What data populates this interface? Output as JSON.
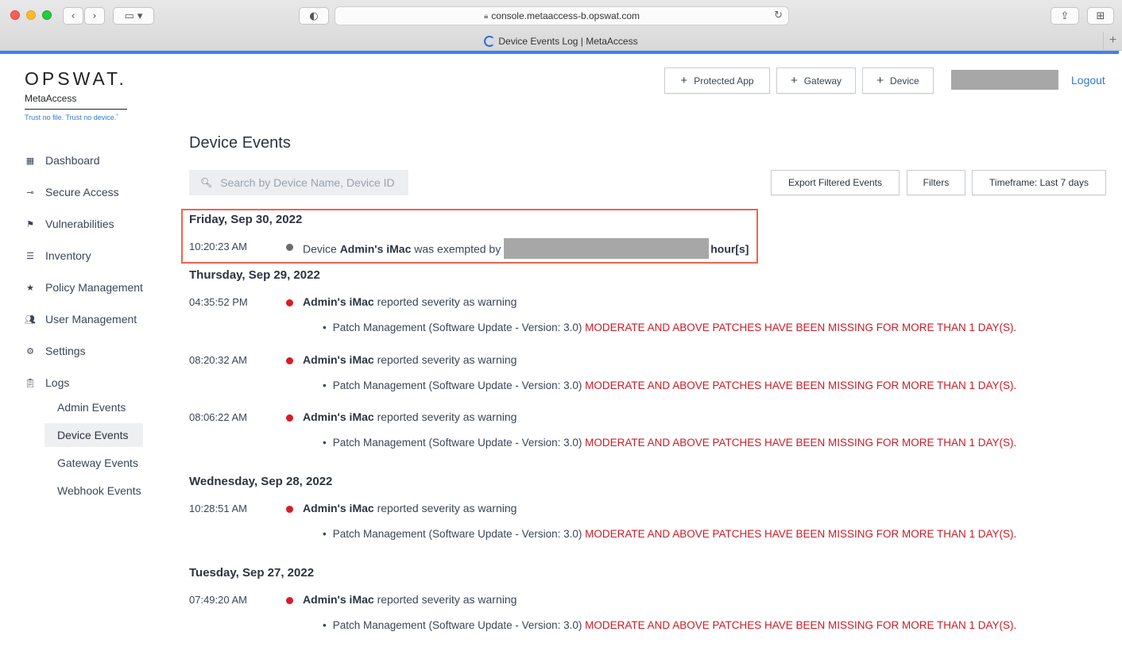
{
  "browser": {
    "url": "console.metaaccess-b.opswat.com",
    "tab_title": "Device Events Log | MetaAccess"
  },
  "brand": {
    "logo": "OPSWAT.",
    "product": "MetaAccess",
    "tagline": "Trust no file. Trust no device.˚"
  },
  "sidebar": {
    "items": [
      {
        "label": "Dashboard",
        "icon": "grid-icon"
      },
      {
        "label": "Secure Access",
        "icon": "key-icon"
      },
      {
        "label": "Vulnerabilities",
        "icon": "flag-icon"
      },
      {
        "label": "Inventory",
        "icon": "list-icon"
      },
      {
        "label": "Policy Management",
        "icon": "star-icon"
      },
      {
        "label": "User Management",
        "icon": "users-icon"
      },
      {
        "label": "Settings",
        "icon": "gear-icon"
      },
      {
        "label": "Logs",
        "icon": "clipboard-icon"
      }
    ],
    "log_items": [
      {
        "label": "Admin Events"
      },
      {
        "label": "Device Events",
        "active": true
      },
      {
        "label": "Gateway Events"
      },
      {
        "label": "Webhook Events"
      }
    ]
  },
  "header": {
    "buttons": [
      "Protected App",
      "Gateway",
      "Device"
    ],
    "logout": "Logout"
  },
  "main": {
    "title": "Device Events",
    "search_placeholder": "Search by Device Name, Device ID",
    "actions": {
      "export": "Export Filtered Events",
      "filters": "Filters",
      "timeframe": "Timeframe: Last 7 days"
    },
    "days": [
      {
        "date": "Friday, Sep 30, 2022",
        "events": [
          {
            "time": "10:20:23 AM",
            "pre": "Device ",
            "device": "Admin's iMac",
            "mid": " was exempted by",
            "post": "hour[s]"
          }
        ]
      },
      {
        "date": "Thursday, Sep 29, 2022",
        "events": [
          {
            "time": "04:35:52 PM",
            "device": "Admin's iMac",
            "text": " reported severity as warning",
            "detail": "Patch Management (Software Update - Version: 3.0)",
            "warning": "MODERATE AND ABOVE PATCHES HAVE BEEN MISSING FOR MORE THAN 1 DAY(S)."
          },
          {
            "time": "08:20:32 AM",
            "device": "Admin's iMac",
            "text": " reported severity as warning",
            "detail": "Patch Management (Software Update - Version: 3.0)",
            "warning": "MODERATE AND ABOVE PATCHES HAVE BEEN MISSING FOR MORE THAN 1 DAY(S)."
          },
          {
            "time": "08:06:22 AM",
            "device": "Admin's iMac",
            "text": " reported severity as warning",
            "detail": "Patch Management (Software Update - Version: 3.0)",
            "warning": "MODERATE AND ABOVE PATCHES HAVE BEEN MISSING FOR MORE THAN 1 DAY(S)."
          }
        ]
      },
      {
        "date": "Wednesday, Sep 28, 2022",
        "events": [
          {
            "time": "10:28:51 AM",
            "device": "Admin's iMac",
            "text": " reported severity as warning",
            "detail": "Patch Management (Software Update - Version: 3.0)",
            "warning": "MODERATE AND ABOVE PATCHES HAVE BEEN MISSING FOR MORE THAN 1 DAY(S)."
          }
        ]
      },
      {
        "date": "Tuesday, Sep 27, 2022",
        "events": [
          {
            "time": "07:49:20 AM",
            "device": "Admin's iMac",
            "text": " reported severity as warning",
            "detail": "Patch Management (Software Update - Version: 3.0)",
            "warning": "MODERATE AND ABOVE PATCHES HAVE BEEN MISSING FOR MORE THAN 1 DAY(S)."
          }
        ]
      }
    ]
  },
  "colors": {
    "accent": "#3578d6",
    "warning": "#cc1b25",
    "highlight": "#f0634f",
    "text": "#3a4656"
  }
}
